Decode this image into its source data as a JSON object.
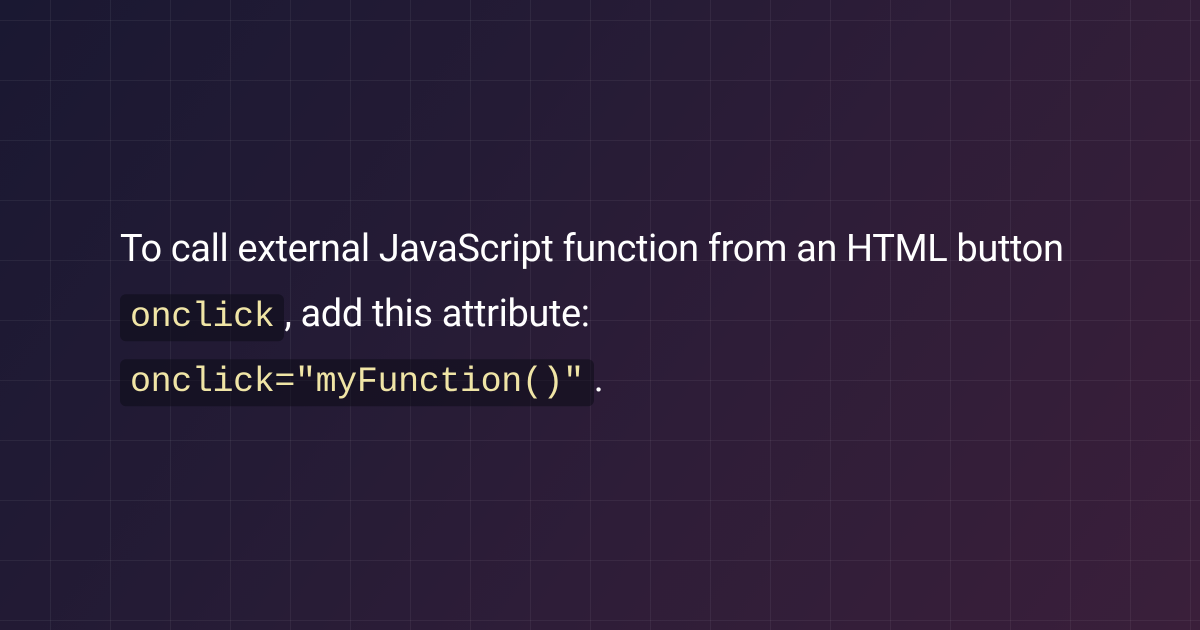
{
  "content": {
    "text_before_code1": "To call external JavaScript function from an HTML button ",
    "code1": "onclick",
    "text_between": ", add this attribute: ",
    "code2": "onclick=\"myFunction()\"",
    "text_after_code2": "."
  }
}
